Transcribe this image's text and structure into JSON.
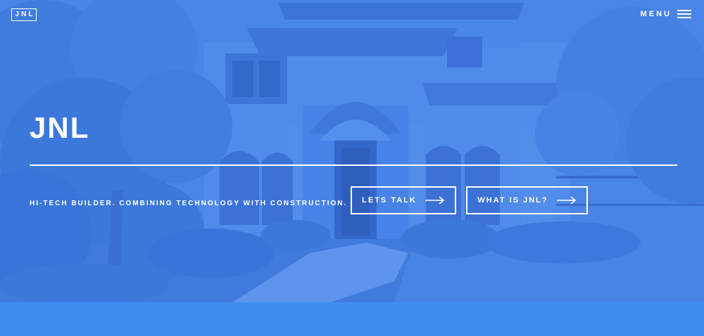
{
  "header": {
    "logo_text": "JNL",
    "menu_label": "MENU"
  },
  "hero": {
    "title": "JNL",
    "tagline": "HI-TECH BUILDER. COMBINING TECHNOLOGY WITH CONSTRUCTION.",
    "buttons": {
      "lets_talk": "LETS TALK",
      "what_is": "WHAT IS JNL?"
    }
  },
  "colors": {
    "overlay": "#4a85e4",
    "band": "#3e8ef0",
    "text": "#ffffff"
  },
  "icons": [
    "hamburger-icon",
    "arrow-right-icon"
  ]
}
